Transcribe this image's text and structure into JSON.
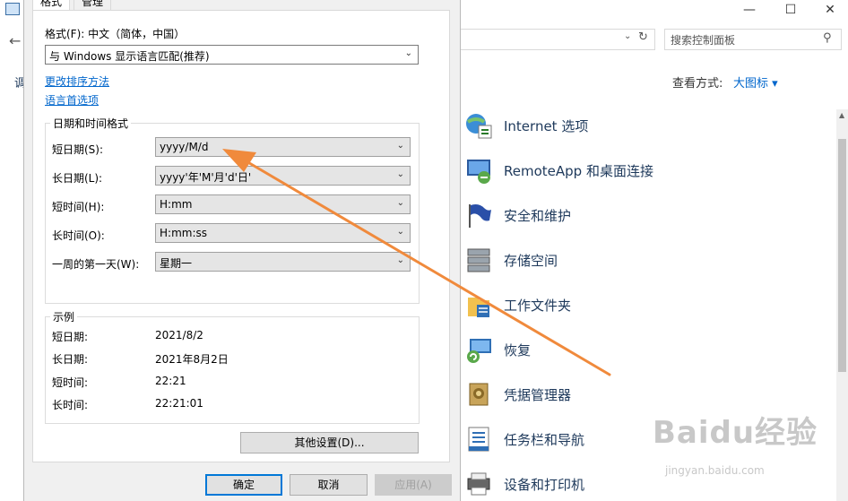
{
  "background_window": {
    "window_controls": {
      "minimize": "—",
      "maximize": "☐",
      "close": "✕"
    },
    "search": {
      "placeholder": "搜索控制面板"
    },
    "view_by": {
      "label": "查看方式:",
      "value": "大图标 ▾"
    },
    "left_partial_text": "调",
    "items": [
      {
        "label": "Internet 选项",
        "icon": "internet-options-icon"
      },
      {
        "label": "RemoteApp 和桌面连接",
        "icon": "remoteapp-icon"
      },
      {
        "label": "安全和维护",
        "icon": "security-flag-icon"
      },
      {
        "label": "存储空间",
        "icon": "storage-spaces-icon"
      },
      {
        "label": "工作文件夹",
        "icon": "work-folders-icon"
      },
      {
        "label": "恢复",
        "icon": "recovery-icon"
      },
      {
        "label": "凭据管理器",
        "icon": "credential-manager-icon"
      },
      {
        "label": "任务栏和导航",
        "icon": "taskbar-icon"
      },
      {
        "label": "设备和打印机",
        "icon": "devices-printers-icon"
      }
    ]
  },
  "dialog": {
    "tabs": [
      "格式",
      "管理"
    ],
    "format_label": "格式(F): 中文（简体，中国）",
    "format_value": "与 Windows 显示语言匹配(推荐)",
    "links": {
      "change_sort": "更改排序方法",
      "language_prefs": "语言首选项"
    },
    "datetime_group": {
      "title": "日期和时间格式",
      "rows": [
        {
          "label": "短日期(S):",
          "value": "yyyy/M/d"
        },
        {
          "label": "长日期(L):",
          "value": "yyyy'年'M'月'd'日'"
        },
        {
          "label": "短时间(H):",
          "value": "H:mm"
        },
        {
          "label": "长时间(O):",
          "value": "H:mm:ss"
        },
        {
          "label": "一周的第一天(W):",
          "value": "星期一"
        }
      ]
    },
    "example_group": {
      "title": "示例",
      "rows": [
        {
          "label": "短日期:",
          "value": "2021/8/2"
        },
        {
          "label": "长日期:",
          "value": "2021年8月2日"
        },
        {
          "label": "短时间:",
          "value": "22:21"
        },
        {
          "label": "长时间:",
          "value": "22:21:01"
        }
      ]
    },
    "other_settings": "其他设置(D)...",
    "buttons": {
      "ok": "确定",
      "cancel": "取消",
      "apply": "应用(A)"
    }
  },
  "watermark": {
    "text": "Baidu经验",
    "sub": "jingyan.baidu.com"
  },
  "colors": {
    "arrow": "#f08a3c",
    "link": "#0066cc",
    "focus": "#0078d7"
  }
}
